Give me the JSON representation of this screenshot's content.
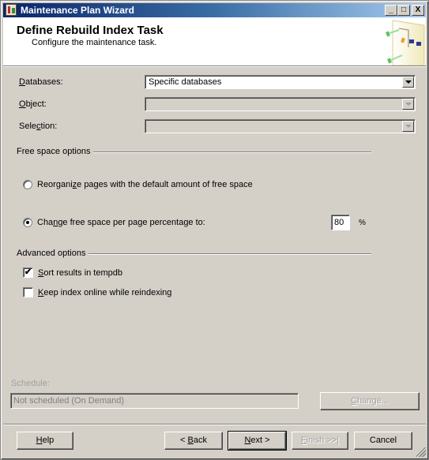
{
  "window": {
    "title": "Maintenance Plan Wizard",
    "controls": {
      "minimize": "_",
      "maximize": "□",
      "close": "X"
    }
  },
  "header": {
    "title": "Define Rebuild Index Task",
    "subtitle": "Configure the maintenance task.",
    "art_icon": "wizard-diagram-icon"
  },
  "form": {
    "databases": {
      "label_hotkey": "D",
      "label_rest": "atabases:",
      "value": "Specific databases"
    },
    "object": {
      "label_hotkey": "O",
      "label_rest": "bject:",
      "value": ""
    },
    "selection": {
      "label_pre": "Sele",
      "label_hotkey": "c",
      "label_rest": "tion:",
      "value": ""
    }
  },
  "free_space": {
    "group_label": "Free space options",
    "option_reorganize": {
      "pre": "Reorgani",
      "hotkey": "z",
      "rest": "e pages with the default amount of free space",
      "checked": false
    },
    "option_change": {
      "pre": "Cha",
      "hotkey": "n",
      "rest": "ge free space per page percentage to:",
      "checked": true
    },
    "percentage_value": "80",
    "percent_sign": "%"
  },
  "advanced": {
    "group_label": "Advanced options",
    "sort_tempdb": {
      "hotkey": "S",
      "rest": "ort results in tempdb",
      "checked": true
    },
    "keep_online": {
      "hotkey": "K",
      "rest": "eep index online while reindexing",
      "checked": false
    }
  },
  "schedule": {
    "label": "Schedule:",
    "value": "Not scheduled (On Demand)",
    "change_button": {
      "hotkey": "C",
      "rest": "hange..."
    }
  },
  "footer": {
    "help": {
      "hotkey": "H",
      "rest": "elp"
    },
    "back": {
      "pre": "< ",
      "hotkey": "B",
      "rest": "ack"
    },
    "next": {
      "hotkey": "N",
      "rest": "ext >"
    },
    "finish": {
      "hotkey": "F",
      "rest": "inish >>|"
    },
    "cancel": "Cancel"
  },
  "check_mark": "✔"
}
